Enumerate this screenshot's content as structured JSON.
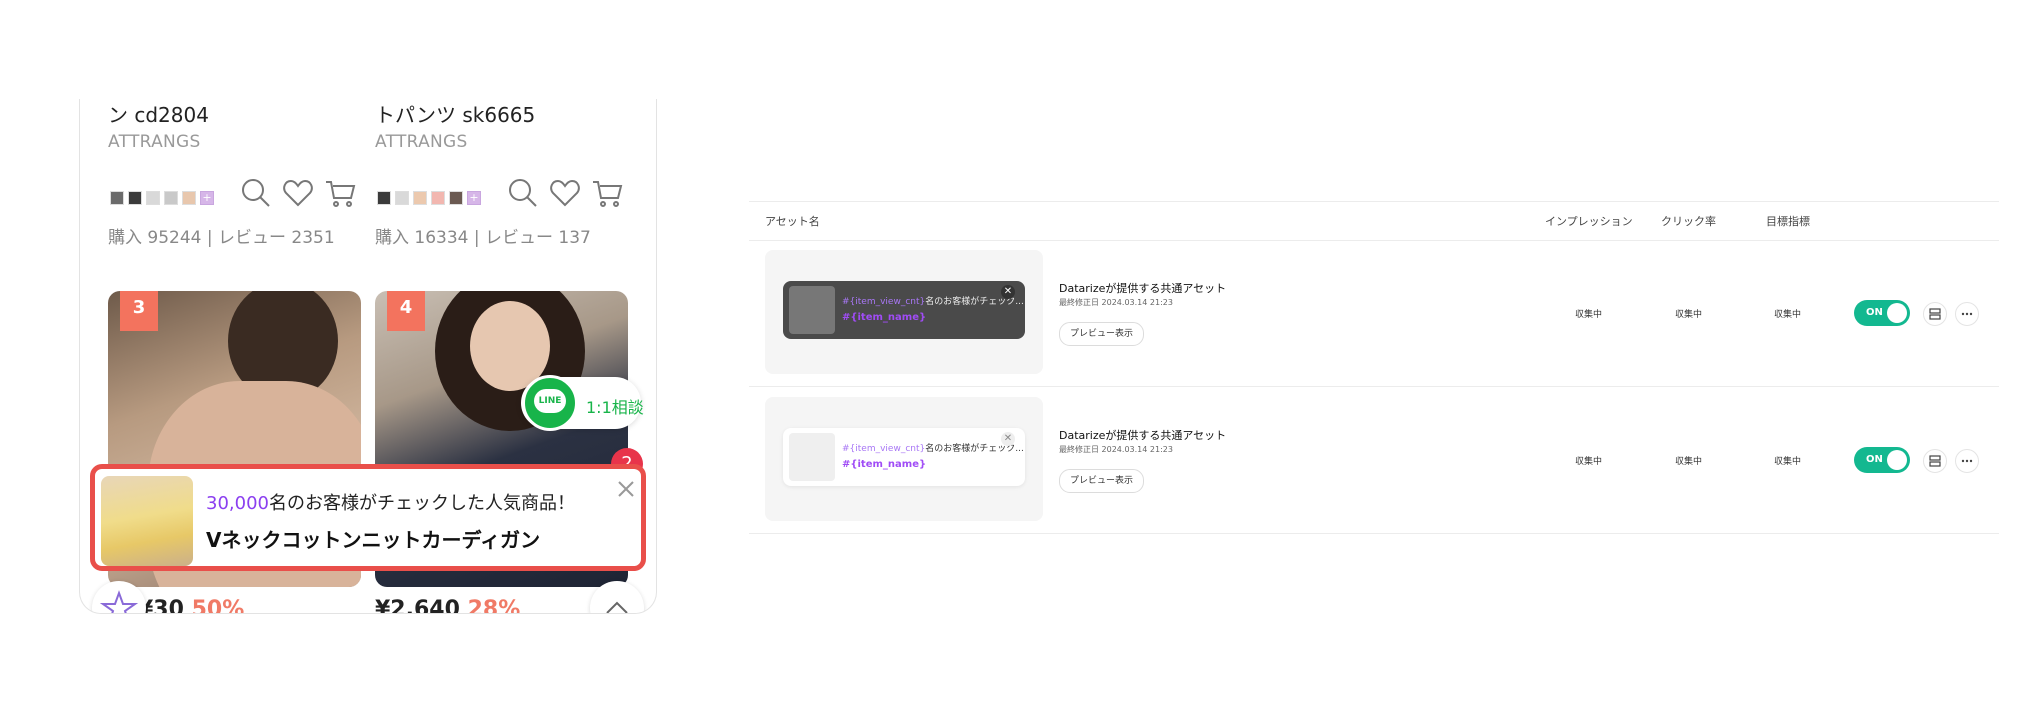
{
  "phone": {
    "products": [
      {
        "name": "ン cd2804",
        "brand": "ATTRANGS",
        "stats": "購入 95244 | レビュー 2351",
        "rank": "3",
        "price": "¥30",
        "discount": "50%",
        "swatches": [
          "#6b6b6b",
          "#3b3b3b",
          "#d9d9d9",
          "#c9c9c9",
          "#e8c7ad"
        ]
      },
      {
        "name": "トパンツ sk6665",
        "brand": "ATTRANGS",
        "stats": "購入 16334 | レビュー 137",
        "rank": "4",
        "price": "¥2,640",
        "discount": "28%",
        "swatches": [
          "#3b3b3b",
          "#d9d9d9",
          "#ecc9ae",
          "#f2b7b0",
          "#6b5a52"
        ]
      }
    ],
    "line": {
      "logo_text": "LINE",
      "label": "1:1相談"
    },
    "notification_count": "2",
    "popup": {
      "count": "30,000",
      "line1_suffix": "名のお客様がチェックした人気商品！",
      "product_name": "Vネックコットンニットカーディガン"
    }
  },
  "table": {
    "headers": {
      "asset_name": "アセット名",
      "impressions": "インプレッション",
      "ctr": "クリック率",
      "target": "目標指標"
    },
    "rows": [
      {
        "theme": "dark",
        "banner_token": "#{item_view_cnt}",
        "banner_suffix": "名のお客様がチェック...",
        "banner_item": "#{item_name}",
        "title": "Datarizeが提供する共通アセット",
        "date": "最終修正日 2024.03.14 21:23",
        "preview_label": "プレビュー表示",
        "impressions": "収集中",
        "ctr": "収集中",
        "target": "収集中",
        "toggle": "ON"
      },
      {
        "theme": "light",
        "banner_token": "#{item_view_cnt}",
        "banner_suffix": "名のお客様がチェック...",
        "banner_item": "#{item_name}",
        "title": "Datarizeが提供する共通アセット",
        "date": "最終修正日 2024.03.14 21:23",
        "preview_label": "プレビュー表示",
        "impressions": "収集中",
        "ctr": "収集中",
        "target": "収集中",
        "toggle": "ON"
      }
    ]
  },
  "colors": {
    "accent_green": "#13b890",
    "popup_border": "#e94f4a",
    "count_purple": "#8b3ff0",
    "rank_badge": "#f3735e",
    "line_green": "#18b44a"
  }
}
